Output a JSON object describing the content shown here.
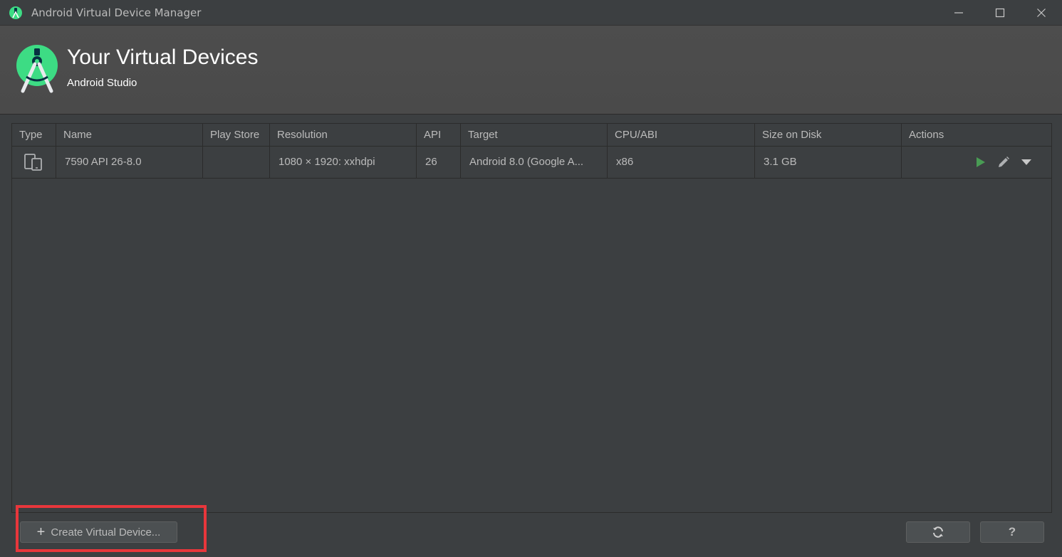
{
  "window": {
    "title": "Android Virtual Device Manager",
    "minimize_glyph": "—",
    "maximize_glyph": "☐",
    "close_glyph": "✕"
  },
  "header": {
    "title": "Your Virtual Devices",
    "subtitle": "Android Studio"
  },
  "table": {
    "columns": [
      "Type",
      "Name",
      "Play Store",
      "Resolution",
      "API",
      "Target",
      "CPU/ABI",
      "Size on Disk",
      "Actions"
    ],
    "rows": [
      {
        "type_icon": "phone-tablet-icon",
        "name": "7590 API 26-8.0",
        "play_store": "",
        "resolution": "1080 × 1920: xxhdpi",
        "api": "26",
        "target": "Android 8.0 (Google A...",
        "cpu_abi": "x86",
        "size_on_disk": "3.1 GB"
      }
    ]
  },
  "footer": {
    "create_label": "Create Virtual Device...",
    "create_icon": "plus-icon",
    "refresh_icon": "refresh-icon",
    "help_label": "?"
  },
  "colors": {
    "background": "#3c3f41",
    "header_bg": "#4b4b4b",
    "accent_green": "#3ddc84",
    "play_green": "#499c54",
    "highlight_red": "#e8363b"
  }
}
